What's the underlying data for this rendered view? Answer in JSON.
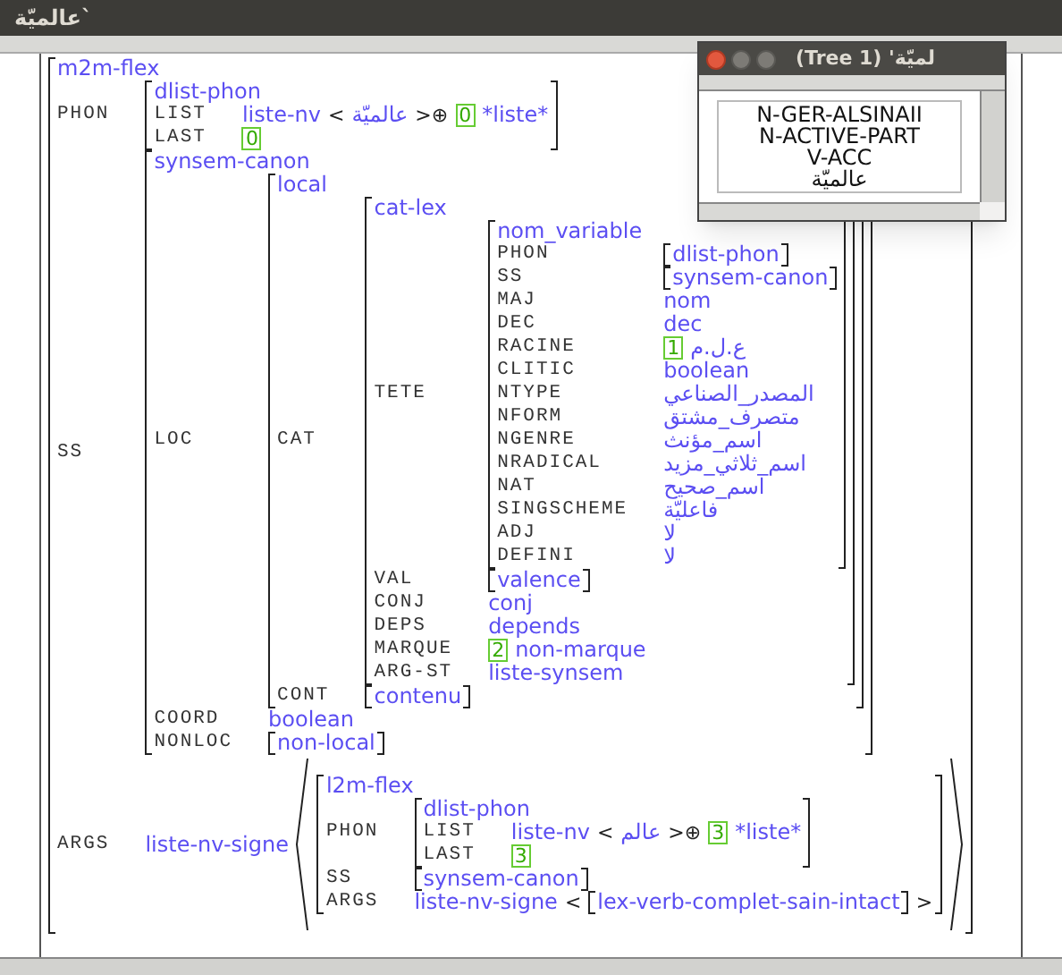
{
  "window": {
    "title": "عالميّة`"
  },
  "tree_window": {
    "title": "(Tree 1) 'لميّة",
    "node_lines": [
      "N-GER-ALSINAII",
      "N-ACTIVE-PART",
      "V-ACC",
      "عالميّة"
    ]
  },
  "structure": {
    "kind": "avm",
    "type": "m2m-flex",
    "features": [
      {
        "name": "PHON",
        "value": {
          "kind": "avm",
          "type": "dlist-phon",
          "features": [
            {
              "name": "LIST",
              "value": {
                "kind": "seq",
                "parts": [
                  {
                    "kind": "type",
                    "text": "liste-nv"
                  },
                  {
                    "kind": "sym",
                    "text": "<"
                  },
                  {
                    "kind": "type",
                    "text": "عالميّة"
                  },
                  {
                    "kind": "sym",
                    "text": ">⊕"
                  },
                  {
                    "kind": "tag",
                    "text": "0"
                  },
                  {
                    "kind": "type",
                    "text": "*liste*"
                  }
                ]
              }
            },
            {
              "name": "LAST",
              "value": {
                "kind": "seq",
                "parts": [
                  {
                    "kind": "tag",
                    "text": "0"
                  }
                ]
              }
            }
          ]
        }
      },
      {
        "name": "SS",
        "value": {
          "kind": "avm",
          "type": "synsem-canon",
          "features": [
            {
              "name": "LOC",
              "value": {
                "kind": "avm",
                "type": "local",
                "features": [
                  {
                    "name": "CAT",
                    "value": {
                      "kind": "avm",
                      "type": "cat-lex",
                      "features": [
                        {
                          "name": "TETE",
                          "value": {
                            "kind": "avm",
                            "type": "nom_variable",
                            "features": [
                              {
                                "name": "PHON",
                                "value": {
                                  "kind": "avm",
                                  "type": "dlist-phon"
                                }
                              },
                              {
                                "name": "SS",
                                "value": {
                                  "kind": "avm",
                                  "type": "synsem-canon"
                                }
                              },
                              {
                                "name": "MAJ",
                                "value": {
                                  "kind": "seq",
                                  "parts": [
                                    {
                                      "kind": "type",
                                      "text": "nom"
                                    }
                                  ]
                                }
                              },
                              {
                                "name": "DEC",
                                "value": {
                                  "kind": "seq",
                                  "parts": [
                                    {
                                      "kind": "type",
                                      "text": "dec"
                                    }
                                  ]
                                }
                              },
                              {
                                "name": "RACINE",
                                "value": {
                                  "kind": "seq",
                                  "parts": [
                                    {
                                      "kind": "tag",
                                      "text": "1"
                                    },
                                    {
                                      "kind": "type",
                                      "text": "ع.ل.م"
                                    }
                                  ]
                                }
                              },
                              {
                                "name": "CLITIC",
                                "value": {
                                  "kind": "seq",
                                  "parts": [
                                    {
                                      "kind": "type",
                                      "text": "boolean"
                                    }
                                  ]
                                }
                              },
                              {
                                "name": "NTYPE",
                                "value": {
                                  "kind": "seq",
                                  "parts": [
                                    {
                                      "kind": "type",
                                      "text": "المصدر_الصناعي"
                                    }
                                  ]
                                }
                              },
                              {
                                "name": "NFORM",
                                "value": {
                                  "kind": "seq",
                                  "parts": [
                                    {
                                      "kind": "type",
                                      "text": "متصرف_مشتق"
                                    }
                                  ]
                                }
                              },
                              {
                                "name": "NGENRE",
                                "value": {
                                  "kind": "seq",
                                  "parts": [
                                    {
                                      "kind": "type",
                                      "text": "اسم_مؤنث"
                                    }
                                  ]
                                }
                              },
                              {
                                "name": "NRADICAL",
                                "value": {
                                  "kind": "seq",
                                  "parts": [
                                    {
                                      "kind": "type",
                                      "text": "اسم_ثلاثي_مزيد"
                                    }
                                  ]
                                }
                              },
                              {
                                "name": "NAT",
                                "value": {
                                  "kind": "seq",
                                  "parts": [
                                    {
                                      "kind": "type",
                                      "text": "اسم_صحيح"
                                    }
                                  ]
                                }
                              },
                              {
                                "name": "SINGSCHEME",
                                "value": {
                                  "kind": "seq",
                                  "parts": [
                                    {
                                      "kind": "type",
                                      "text": "فاعليّة"
                                    }
                                  ]
                                }
                              },
                              {
                                "name": "ADJ",
                                "value": {
                                  "kind": "seq",
                                  "parts": [
                                    {
                                      "kind": "type",
                                      "text": "لا"
                                    }
                                  ]
                                }
                              },
                              {
                                "name": "DEFINI",
                                "value": {
                                  "kind": "seq",
                                  "parts": [
                                    {
                                      "kind": "type",
                                      "text": "لا"
                                    }
                                  ]
                                }
                              }
                            ]
                          }
                        },
                        {
                          "name": "VAL",
                          "value": {
                            "kind": "avm",
                            "type": "valence"
                          }
                        },
                        {
                          "name": "CONJ",
                          "value": {
                            "kind": "seq",
                            "parts": [
                              {
                                "kind": "type",
                                "text": "conj"
                              }
                            ]
                          }
                        },
                        {
                          "name": "DEPS",
                          "value": {
                            "kind": "seq",
                            "parts": [
                              {
                                "kind": "type",
                                "text": "depends"
                              }
                            ]
                          }
                        },
                        {
                          "name": "MARQUE",
                          "value": {
                            "kind": "seq",
                            "parts": [
                              {
                                "kind": "tag",
                                "text": "2"
                              },
                              {
                                "kind": "type",
                                "text": "non-marque"
                              }
                            ]
                          }
                        },
                        {
                          "name": "ARG-ST",
                          "value": {
                            "kind": "seq",
                            "parts": [
                              {
                                "kind": "type",
                                "text": "liste-synsem"
                              }
                            ]
                          }
                        }
                      ]
                    }
                  },
                  {
                    "name": "CONT",
                    "value": {
                      "kind": "avm",
                      "type": "contenu"
                    }
                  }
                ]
              }
            },
            {
              "name": "COORD",
              "value": {
                "kind": "seq",
                "parts": [
                  {
                    "kind": "type",
                    "text": "boolean"
                  }
                ]
              }
            },
            {
              "name": "NONLOC",
              "value": {
                "kind": "avm",
                "type": "non-local"
              }
            }
          ]
        }
      },
      {
        "name": "ARGS",
        "value": {
          "kind": "seq",
          "parts": [
            {
              "kind": "type",
              "text": "liste-nv-signe"
            },
            {
              "kind": "open"
            },
            {
              "kind": "avm",
              "type": "l2m-flex",
              "features": [
                {
                  "name": "PHON",
                  "value": {
                    "kind": "avm",
                    "type": "dlist-phon",
                    "features": [
                      {
                        "name": "LIST",
                        "value": {
                          "kind": "seq",
                          "parts": [
                            {
                              "kind": "type",
                              "text": "liste-nv"
                            },
                            {
                              "kind": "sym",
                              "text": "<"
                            },
                            {
                              "kind": "type",
                              "text": "عالم"
                            },
                            {
                              "kind": "sym",
                              "text": ">⊕"
                            },
                            {
                              "kind": "tag",
                              "text": "3"
                            },
                            {
                              "kind": "type",
                              "text": "*liste*"
                            }
                          ]
                        }
                      },
                      {
                        "name": "LAST",
                        "value": {
                          "kind": "seq",
                          "parts": [
                            {
                              "kind": "tag",
                              "text": "3"
                            }
                          ]
                        }
                      }
                    ]
                  }
                },
                {
                  "name": "SS",
                  "value": {
                    "kind": "avm",
                    "type": "synsem-canon"
                  }
                },
                {
                  "name": "ARGS",
                  "value": {
                    "kind": "seq",
                    "parts": [
                      {
                        "kind": "type",
                        "text": "liste-nv-signe"
                      },
                      {
                        "kind": "sym",
                        "text": "<"
                      },
                      {
                        "kind": "avm",
                        "type": "lex-verb-complet-sain-intact"
                      },
                      {
                        "kind": "sym",
                        "text": ">"
                      }
                    ]
                  }
                }
              ]
            },
            {
              "kind": "close"
            }
          ]
        }
      }
    ]
  }
}
